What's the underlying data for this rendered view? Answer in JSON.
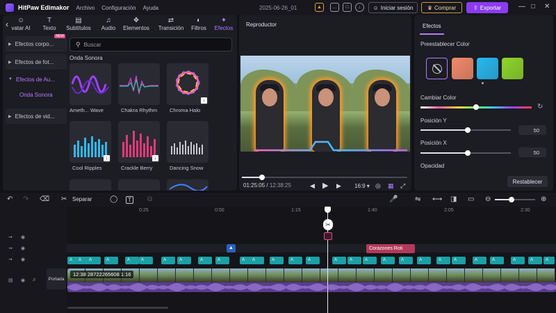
{
  "titlebar": {
    "app_name": "HitPaw Edimakor",
    "menus": [
      "Archivo",
      "Configuración",
      "Ayuda"
    ],
    "project": "2025-06-26_01",
    "login": "Iniciar sesión",
    "buy": "Comprar",
    "export": "Exportar"
  },
  "tabs": [
    "vatar AI",
    "Texto",
    "Subtítulos",
    "Audio",
    "Elementos",
    "Transición",
    "Filtros",
    "Efectos"
  ],
  "tab_icons": [
    "avatar-icon",
    "text-icon",
    "subtitles-icon",
    "audio-icon",
    "elements-icon",
    "transition-icon",
    "filters-icon",
    "effects-icon"
  ],
  "categories": [
    "Efectos corpo...",
    "Efectos de fot...",
    "Efectos de Au...",
    "Efectos de vid..."
  ],
  "subcategory": "Onda Sonora",
  "new_badge": "NEW",
  "search": {
    "placeholder": "Buscar"
  },
  "section_title": "Onda Sonora",
  "effects": [
    "Ameth... Wave",
    "Chakra Rhythm",
    "Chroma Halo",
    "Cool Ripples",
    "Crackle Berry",
    "Dancing Snow"
  ],
  "player": {
    "title": "Reproductor",
    "current": "01:25:05",
    "total": "12:38:25",
    "ratio": "16:9",
    "progress": 0.12
  },
  "props": {
    "tab": "Efectos",
    "preset_label": "Preestablecer Color",
    "change_color": "Cambiar Color",
    "pos_y_label": "Posición Y",
    "pos_y": "50",
    "pos_x_label": "Posición X",
    "pos_x": "50",
    "opacity_label": "Opacidad",
    "reset": "Restablecer",
    "colors": [
      "#f08a6a",
      "#28b8f0",
      "#8ed62a"
    ],
    "accent": "#8b3cf0"
  },
  "toolbar": {
    "split": "Separar"
  },
  "timeline": {
    "ticks": [
      "0:25",
      "0:50",
      "1:15",
      "1:40",
      "2:05",
      "2:30"
    ],
    "clip_text": "12:38 28722265608 1:16",
    "cover": "Portada",
    "effect_clip": "Corazones Roti",
    "teal_clip": "A"
  }
}
